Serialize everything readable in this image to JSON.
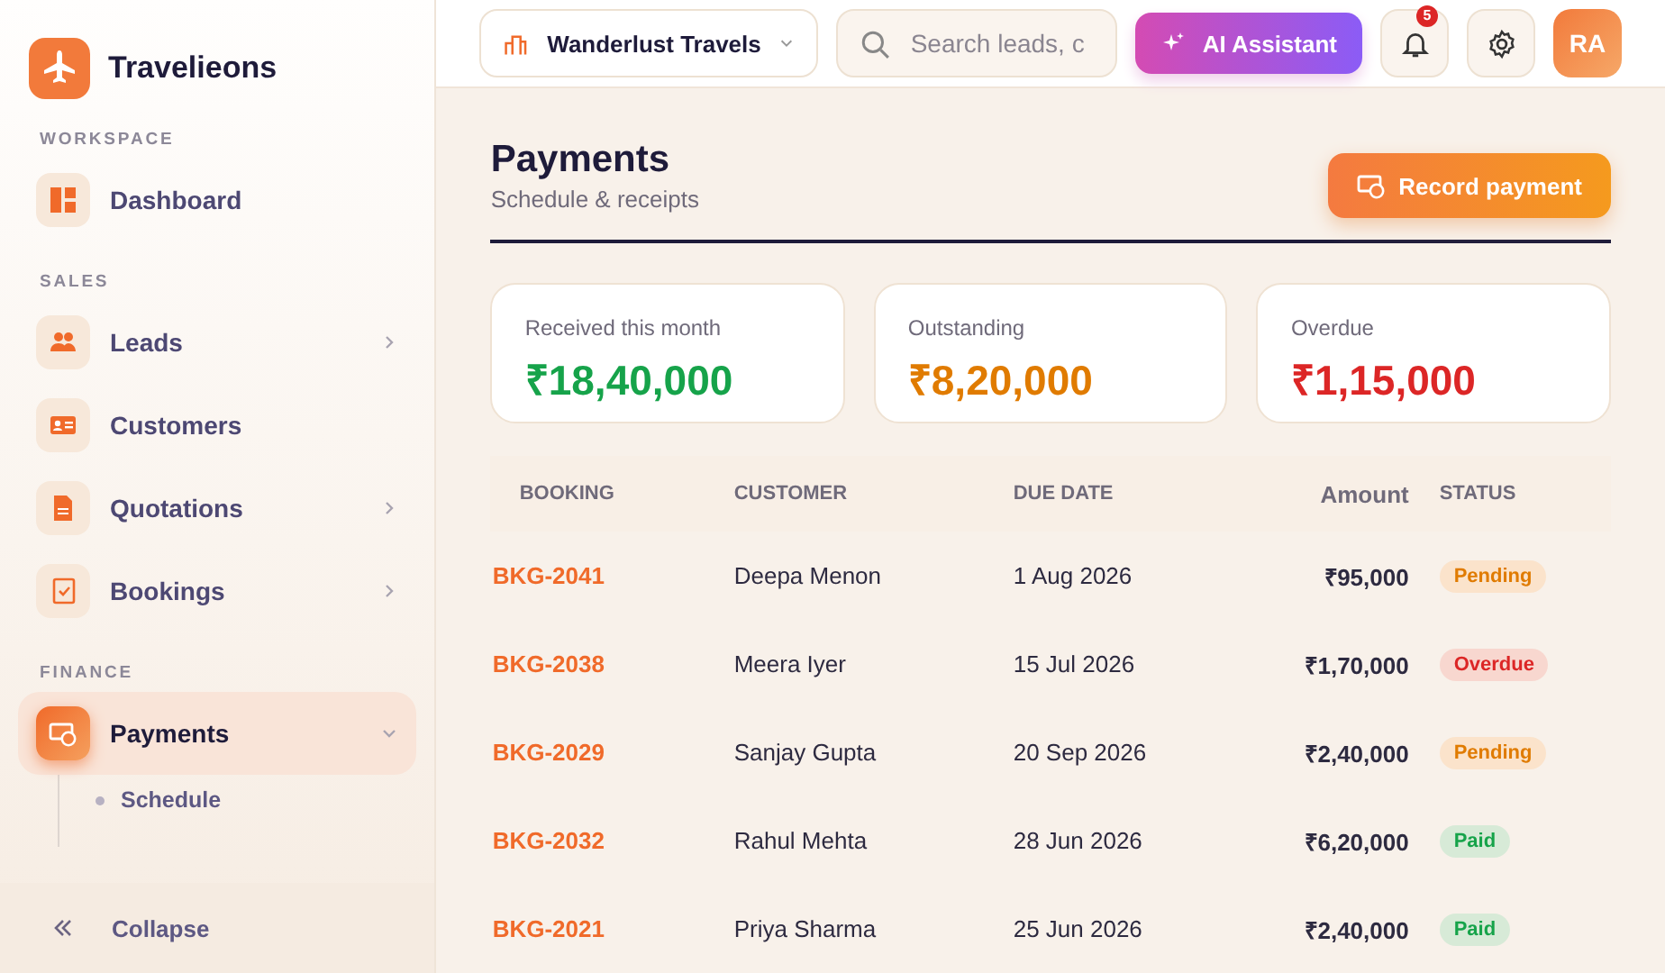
{
  "brand": {
    "name": "Travelieons"
  },
  "sidebar": {
    "sections": [
      {
        "label": "WORKSPACE",
        "items": [
          {
            "label": "Dashboard",
            "kind": "link",
            "selected": false
          }
        ]
      },
      {
        "label": "SALES",
        "items": [
          {
            "label": "Leads",
            "kind": "group",
            "expanded": false,
            "selected": false
          },
          {
            "label": "Customers",
            "kind": "link",
            "selected": false
          },
          {
            "label": "Quotations",
            "kind": "group",
            "expanded": false,
            "selected": false
          },
          {
            "label": "Bookings",
            "kind": "group",
            "expanded": false,
            "selected": false
          }
        ]
      },
      {
        "label": "FINANCE",
        "items": [
          {
            "label": "Payments",
            "kind": "group",
            "expanded": true,
            "selected": true,
            "children": [
              {
                "label": "Schedule",
                "selected": false
              }
            ]
          }
        ]
      }
    ],
    "collapse": "Collapse"
  },
  "topbar": {
    "agency": "Wanderlust Travels",
    "search": {
      "placeholder": "Search leads, c"
    },
    "ai_button": "AI Assistant",
    "notifications": "5",
    "avatar": "RA"
  },
  "page": {
    "title": "Payments",
    "subtitle": "Schedule & receipts",
    "action": "Record payment"
  },
  "stats": [
    {
      "label": "Received this month",
      "value": "₹18,40,000",
      "color": "#16a34a"
    },
    {
      "label": "Outstanding",
      "value": "₹8,20,000",
      "color": "#e07b00"
    },
    {
      "label": "Overdue",
      "value": "₹1,15,000",
      "color": "#dc2626"
    }
  ],
  "table": {
    "columns": [
      "BOOKING",
      "CUSTOMER",
      "DUE DATE",
      "Amount",
      "STATUS"
    ],
    "rows": [
      {
        "booking": "BKG-2041",
        "customer": "Deepa Menon",
        "due": "1 Aug 2026",
        "amount": "₹95,000",
        "status": {
          "label": "Pending",
          "kind": "pending"
        }
      },
      {
        "booking": "BKG-2038",
        "customer": "Meera Iyer",
        "due": "15 Jul 2026",
        "amount": "₹1,70,000",
        "status": {
          "label": "Overdue",
          "kind": "overdue"
        }
      },
      {
        "booking": "BKG-2029",
        "customer": "Sanjay Gupta",
        "due": "20 Sep 2026",
        "amount": "₹2,40,000",
        "status": {
          "label": "Pending",
          "kind": "pending"
        }
      },
      {
        "booking": "BKG-2032",
        "customer": "Rahul Mehta",
        "due": "28 Jun 2026",
        "amount": "₹6,20,000",
        "status": {
          "label": "Paid",
          "kind": "paid"
        }
      },
      {
        "booking": "BKG-2021",
        "customer": "Priya Sharma",
        "due": "25 Jun 2026",
        "amount": "₹2,40,000",
        "status": {
          "label": "Paid",
          "kind": "paid"
        }
      }
    ]
  }
}
